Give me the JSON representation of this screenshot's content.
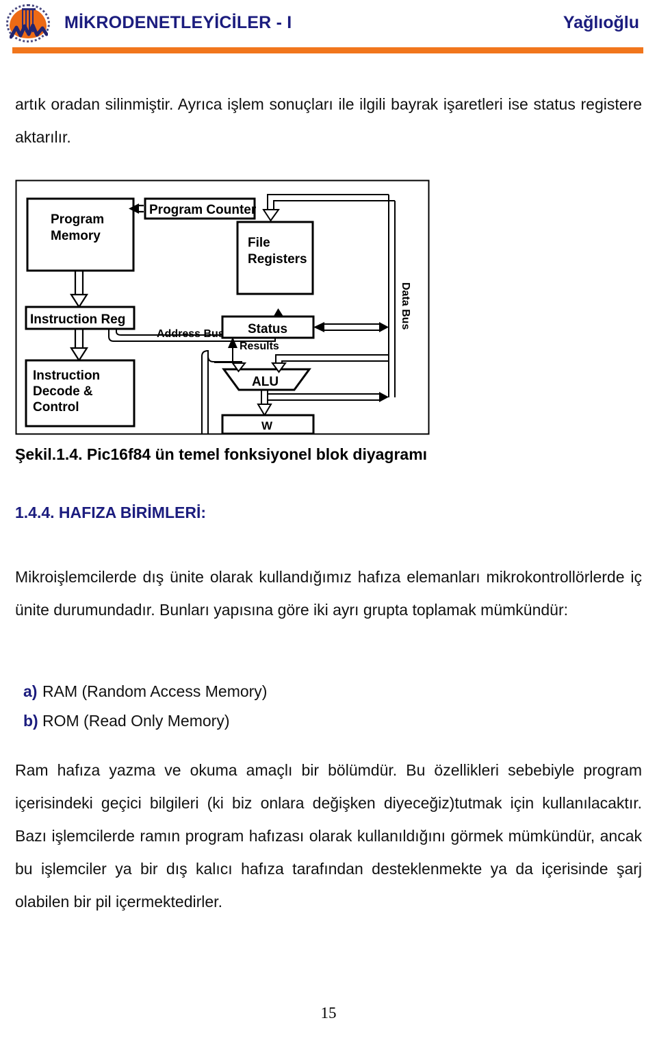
{
  "header": {
    "title": "MİKRODENETLEYİCİLER - I",
    "author": "Yağlıoğlu",
    "logo_name": "university-seal-logo",
    "accent_color": "#F1761C",
    "title_color": "#1B1C7E"
  },
  "body": {
    "intro_paragraph": "artık oradan silinmiştir. Ayrıca işlem sonuçları ile ilgili bayrak işaretleri ise status registere aktarılır.",
    "figure_caption": "Şekil.1.4. Pic16f84 ün temel  fonksiyonel blok diyagramı",
    "section_heading": "1.4.4. HAFIZA BİRİMLERİ:",
    "hafiza_paragraph": "Mikroişlemcilerde dış ünite olarak kullandığımız hafıza elemanları mikrokontrollörlerde iç ünite durumundadır.  Bunları yapısına göre iki ayrı grupta toplamak mümkündür:",
    "memory_list": [
      {
        "marker": "a)",
        "text": "RAM (Random Access Memory)"
      },
      {
        "marker": "b)",
        "text": "ROM (Read Only Memory)"
      }
    ],
    "ram_paragraph": "Ram hafıza yazma ve okuma amaçlı bir bölümdür. Bu özellikleri sebebiyle program içerisindeki geçici bilgileri (ki biz onlara değişken diyeceğiz)tutmak için kullanılacaktır. Bazı işlemcilerde ramın program hafızası olarak kullanıldığını görmek mümkündür, ancak bu işlemciler ya bir dış kalıcı hafıza tarafından desteklenmekte ya da içerisinde şarj olabilen bir pil içermektedirler.",
    "page_number": "15"
  },
  "figure": {
    "name": "pic16f84-block-diagram",
    "blocks": {
      "program_memory": "Program\nMemory",
      "program_memory_l1": "Program",
      "program_memory_l2": "Memory",
      "program_counter": "Program Counter",
      "instruction_reg": "Instruction Reg",
      "instruction_decode_l1": "Instruction",
      "instruction_decode_l2": "Decode &",
      "instruction_decode_l3": "Control",
      "file_registers_l1": "File",
      "file_registers_l2": "Registers",
      "status": "Status",
      "alu": "ALU",
      "w": "W"
    },
    "labels": {
      "address_bus": "Address Bus",
      "data_bus": "Data Bus",
      "results": "Results"
    }
  }
}
